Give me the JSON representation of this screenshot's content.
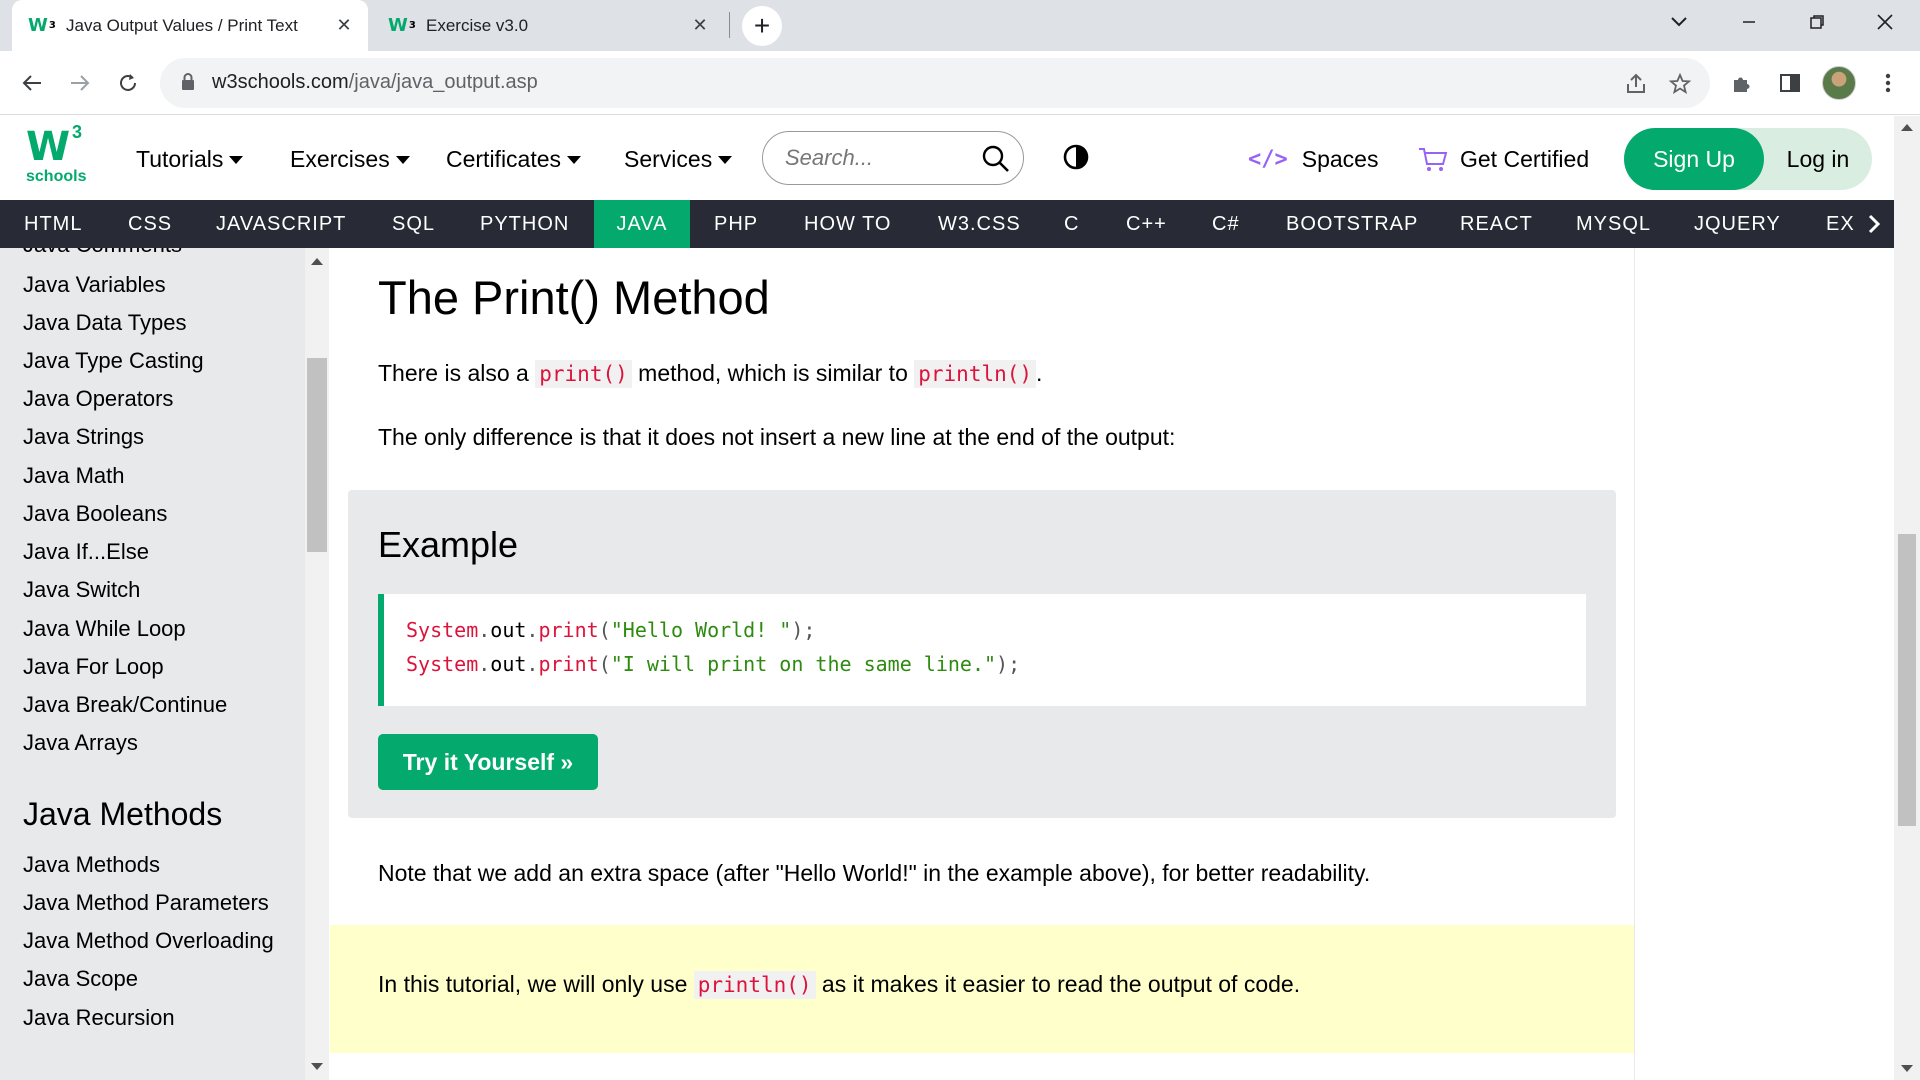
{
  "browser": {
    "tabs": [
      {
        "title": "Java Output Values / Print Text",
        "active": true
      },
      {
        "title": "Exercise v3.0",
        "active": false
      }
    ],
    "new_tab_symbol": "+",
    "close_symbol": "✕",
    "url_domain": "w3schools.com",
    "url_path": "/java/java_output.asp",
    "icons": [
      "back-icon",
      "forward-icon",
      "reload-icon",
      "lock-icon",
      "share-icon",
      "star-icon",
      "extensions-icon",
      "sidepanel-icon",
      "profile-avatar",
      "menu-icon"
    ]
  },
  "header": {
    "logo_number": "3",
    "logo_text": "schools",
    "menu": [
      {
        "label": "Tutorials"
      },
      {
        "label": "Exercises"
      },
      {
        "label": "Certificates"
      },
      {
        "label": "Services"
      }
    ],
    "search_placeholder": "Search...",
    "spaces_label": "Spaces",
    "get_certified_label": "Get Certified",
    "signup_label": "Sign Up",
    "login_label": "Log in"
  },
  "topnav": {
    "items": [
      "HTML",
      "CSS",
      "JAVASCRIPT",
      "SQL",
      "PYTHON",
      "JAVA",
      "PHP",
      "HOW TO",
      "W3.CSS",
      "C",
      "C++",
      "C#",
      "BOOTSTRAP",
      "REACT",
      "MYSQL",
      "JQUERY",
      "EX"
    ],
    "active": "JAVA"
  },
  "sidebar": {
    "partial_top": "Java Comments",
    "links": [
      "Java Variables",
      "Java Data Types",
      "Java Type Casting",
      "Java Operators",
      "Java Strings",
      "Java Math",
      "Java Booleans",
      "Java If...Else",
      "Java Switch",
      "Java While Loop",
      "Java For Loop",
      "Java Break/Continue",
      "Java Arrays"
    ],
    "section_heading": "Java Methods",
    "method_links": [
      "Java Methods",
      "Java Method Parameters",
      "Java Method Overloading",
      "Java Scope",
      "Java Recursion"
    ]
  },
  "main": {
    "title": "The Print() Method",
    "p1_a": "There is also a ",
    "p1_code1": "print()",
    "p1_b": " method, which is similar to ",
    "p1_code2": "println()",
    "p1_c": ".",
    "p2": "The only difference is that it does not insert a new line at the end of the output:",
    "example_heading": "Example",
    "code_lines": [
      {
        "obj": "System",
        "dot1": ".",
        "field": "out",
        "dot2": ".",
        "method": "print",
        "open": "(",
        "str": "\"Hello World! \"",
        "close": ");"
      },
      {
        "obj": "System",
        "dot1": ".",
        "field": "out",
        "dot2": ".",
        "method": "print",
        "open": "(",
        "str": "\"I will print on the same line.\"",
        "close": ");"
      }
    ],
    "try_button": "Try it Yourself »",
    "note": "Note that we add an extra space (after \"Hello World!\" in the example above), for better readability.",
    "tip_a": "In this tutorial, we will only use ",
    "tip_code": "println()",
    "tip_b": " as it makes it easier to read the output of code."
  },
  "colors": {
    "brand_green": "#04aa6d",
    "nav_dark": "#282a35",
    "sidebar_bg": "#e7e9eb",
    "code_red": "#dc143c",
    "note_yellow": "#ffffcc"
  }
}
